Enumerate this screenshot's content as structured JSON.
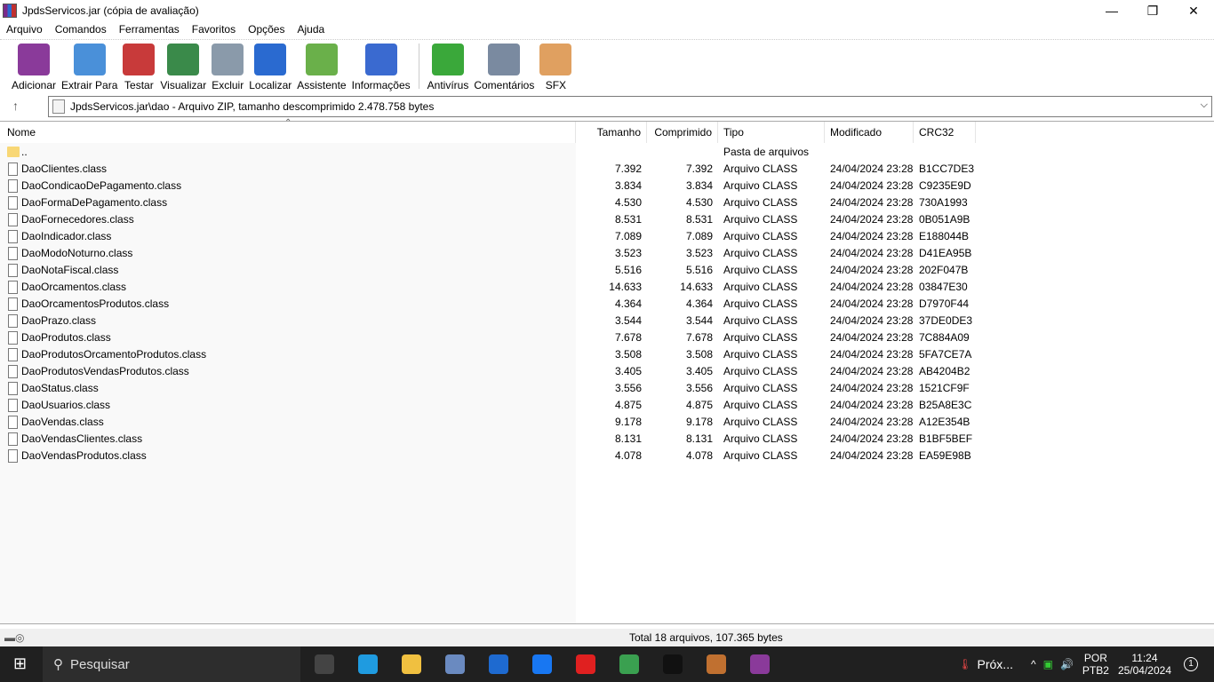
{
  "window": {
    "title": "JpdsServicos.jar (cópia de avaliação)",
    "minimize": "—",
    "maximize": "❐",
    "close": "✕"
  },
  "menu": [
    "Arquivo",
    "Comandos",
    "Ferramentas",
    "Favoritos",
    "Opções",
    "Ajuda"
  ],
  "toolbar": [
    {
      "label": "Adicionar",
      "icon": "archive-add-icon",
      "color": "#8a3a9a"
    },
    {
      "label": "Extrair Para",
      "icon": "folder-extract-icon",
      "color": "#4a90d9"
    },
    {
      "label": "Testar",
      "icon": "clipboard-check-icon",
      "color": "#c83a3a"
    },
    {
      "label": "Visualizar",
      "icon": "book-icon",
      "color": "#3a8a4a"
    },
    {
      "label": "Excluir",
      "icon": "trash-icon",
      "color": "#8a9aaa"
    },
    {
      "label": "Localizar",
      "icon": "magnifier-icon",
      "color": "#2a6ad0"
    },
    {
      "label": "Assistente",
      "icon": "wand-icon",
      "color": "#6ab04a"
    },
    {
      "label": "Informações",
      "icon": "info-icon",
      "color": "#3a6ad0"
    },
    {
      "label": "Antivírus",
      "icon": "shield-bug-icon",
      "color": "#3aa83a"
    },
    {
      "label": "Comentários",
      "icon": "comment-icon",
      "color": "#7a8aa0"
    },
    {
      "label": "SFX",
      "icon": "box-icon",
      "color": "#e0a060"
    }
  ],
  "address": {
    "up": "↑",
    "path": "JpdsServicos.jar\\dao - Arquivo ZIP, tamanho descomprimido 2.478.758 bytes",
    "dropdown": "⌵"
  },
  "columns": [
    "Nome",
    "Tamanho",
    "Comprimido",
    "Tipo",
    "Modificado",
    "CRC32"
  ],
  "sort_indicator": "⌃",
  "parent": {
    "name": "..",
    "type": "Pasta de arquivos"
  },
  "files": [
    [
      "DaoClientes.class",
      "7.392",
      "7.392",
      "Arquivo CLASS",
      "24/04/2024 23:28",
      "B1CC7DE3"
    ],
    [
      "DaoCondicaoDePagamento.class",
      "3.834",
      "3.834",
      "Arquivo CLASS",
      "24/04/2024 23:28",
      "C9235E9D"
    ],
    [
      "DaoFormaDePagamento.class",
      "4.530",
      "4.530",
      "Arquivo CLASS",
      "24/04/2024 23:28",
      "730A1993"
    ],
    [
      "DaoFornecedores.class",
      "8.531",
      "8.531",
      "Arquivo CLASS",
      "24/04/2024 23:28",
      "0B051A9B"
    ],
    [
      "DaoIndicador.class",
      "7.089",
      "7.089",
      "Arquivo CLASS",
      "24/04/2024 23:28",
      "E188044B"
    ],
    [
      "DaoModoNoturno.class",
      "3.523",
      "3.523",
      "Arquivo CLASS",
      "24/04/2024 23:28",
      "D41EA95B"
    ],
    [
      "DaoNotaFiscal.class",
      "5.516",
      "5.516",
      "Arquivo CLASS",
      "24/04/2024 23:28",
      "202F047B"
    ],
    [
      "DaoOrcamentos.class",
      "14.633",
      "14.633",
      "Arquivo CLASS",
      "24/04/2024 23:28",
      "03847E30"
    ],
    [
      "DaoOrcamentosProdutos.class",
      "4.364",
      "4.364",
      "Arquivo CLASS",
      "24/04/2024 23:28",
      "D7970F44"
    ],
    [
      "DaoPrazo.class",
      "3.544",
      "3.544",
      "Arquivo CLASS",
      "24/04/2024 23:28",
      "37DE0DE3"
    ],
    [
      "DaoProdutos.class",
      "7.678",
      "7.678",
      "Arquivo CLASS",
      "24/04/2024 23:28",
      "7C884A09"
    ],
    [
      "DaoProdutosOrcamentoProdutos.class",
      "3.508",
      "3.508",
      "Arquivo CLASS",
      "24/04/2024 23:28",
      "5FA7CE7A"
    ],
    [
      "DaoProdutosVendasProdutos.class",
      "3.405",
      "3.405",
      "Arquivo CLASS",
      "24/04/2024 23:28",
      "AB4204B2"
    ],
    [
      "DaoStatus.class",
      "3.556",
      "3.556",
      "Arquivo CLASS",
      "24/04/2024 23:28",
      "1521CF9F"
    ],
    [
      "DaoUsuarios.class",
      "4.875",
      "4.875",
      "Arquivo CLASS",
      "24/04/2024 23:28",
      "B25A8E3C"
    ],
    [
      "DaoVendas.class",
      "9.178",
      "9.178",
      "Arquivo CLASS",
      "24/04/2024 23:28",
      "A12E354B"
    ],
    [
      "DaoVendasClientes.class",
      "8.131",
      "8.131",
      "Arquivo CLASS",
      "24/04/2024 23:28",
      "B1BF5BEF"
    ],
    [
      "DaoVendasProdutos.class",
      "4.078",
      "4.078",
      "Arquivo CLASS",
      "24/04/2024 23:28",
      "EA59E98B"
    ]
  ],
  "status": {
    "total": "Total 18 arquivos, 107.365 bytes"
  },
  "taskbar": {
    "search": "Pesquisar",
    "weather": "Próx...",
    "lang1": "POR",
    "lang2": "PTB2",
    "time": "11:24",
    "date": "25/04/2024",
    "notifications": "1",
    "apps": [
      {
        "name": "task-view",
        "color": "#444"
      },
      {
        "name": "edge",
        "color": "#1f9be0"
      },
      {
        "name": "file-explorer",
        "color": "#f0c040"
      },
      {
        "name": "control-panel",
        "color": "#6a8ac0"
      },
      {
        "name": "app-blue",
        "color": "#1e6ad0"
      },
      {
        "name": "facebook",
        "color": "#1877f2"
      },
      {
        "name": "youtube",
        "color": "#e02020"
      },
      {
        "name": "chrome",
        "color": "#3aa050"
      },
      {
        "name": "terminal",
        "color": "#111"
      },
      {
        "name": "app-cube",
        "color": "#c07030"
      },
      {
        "name": "winrar",
        "color": "#8a3a9a"
      }
    ]
  }
}
